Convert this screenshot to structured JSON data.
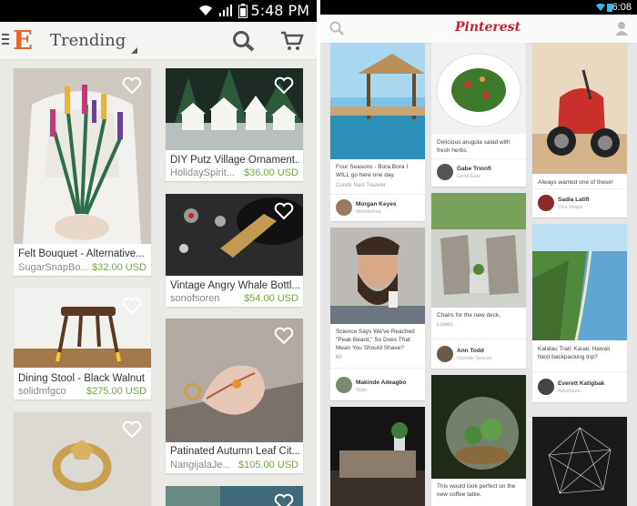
{
  "etsy": {
    "status_time": "5:48 PM",
    "logo": "E",
    "title": "Trending",
    "icons": {
      "menu": "menu-icon",
      "search": "search-icon",
      "cart": "cart-icon",
      "favorite": "heart-icon"
    },
    "accent": "#e0692a",
    "price_color": "#70a83b",
    "items": [
      {
        "title": "Felt Bouquet  - Alternative...",
        "shop": "SugarSnapBo...",
        "price": "$32.00 USD"
      },
      {
        "title": "DIY Putz Village Ornament...",
        "shop": "HolidaySpirit...",
        "price": "$36.00 USD"
      },
      {
        "title": "Vintage Angry Whale Bottl...",
        "shop": "sonofsoren",
        "price": "$54.00 USD"
      },
      {
        "title": "Dining Stool - Black Walnut",
        "shop": "solidmfgco",
        "price": "$275.00 USD"
      },
      {
        "title": "Patinated Autumn Leaf Cit...",
        "shop": "NangijalaJe...",
        "price": "$105.00 USD"
      }
    ]
  },
  "pinterest": {
    "status_time": "6:08",
    "logo": "Pinterest",
    "brand_color": "#cb2027",
    "icons": {
      "search": "search-icon",
      "profile": "profile-icon"
    },
    "pins": [
      {
        "desc": "Four Seasons - Bora Bora I WILL go here one day.",
        "source": "Condé Nast Traveler",
        "user": "Morgan Keyes",
        "board": "Wanderlust"
      },
      {
        "desc": "Delicious arugula salad with fresh herbs.",
        "user": "Gabe Trionfi",
        "board": "Good Eats"
      },
      {
        "desc": "Always wanted one of these!",
        "user": "Sadia Latifi",
        "board": "Viva Vespa"
      },
      {
        "desc": "Science Says We've Reached \"Peak Beard,\" So Does That Mean You Should Shave?",
        "stats": "60",
        "user": "Makinde Adeagbo",
        "board": "Style"
      },
      {
        "desc": "Chairs for the new deck.",
        "source": "Lowes",
        "user": "Ann Todd",
        "board": "Outside Spaces"
      },
      {
        "desc": "Kalalau Trail: Kauai, Hawaii Next backpacking trip?",
        "user": "Everett Katigbak",
        "board": "Adventure"
      },
      {
        "desc": "This would look perfect on the new coffee table."
      }
    ]
  }
}
